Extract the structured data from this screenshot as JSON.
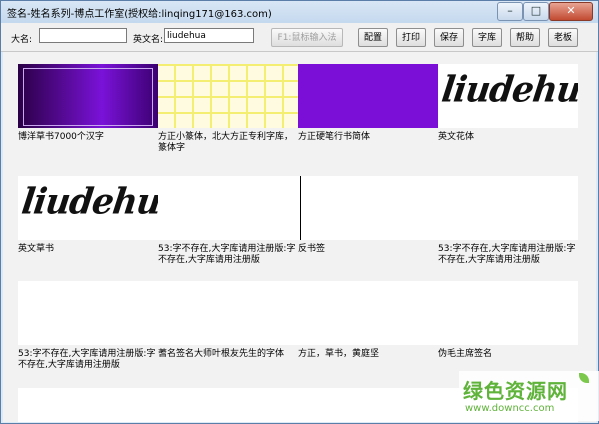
{
  "window": {
    "title": "签名-姓名系列-博点工作室(授权给:linqing171@163.com)"
  },
  "toolbar": {
    "name_label": "大名:",
    "name_value": "",
    "en_label": "英文名:",
    "en_value": "liudehua",
    "input_btn": "F1:鼠标输入法",
    "buttons": [
      "配置",
      "打印",
      "保存",
      "字库",
      "帮助",
      "老板"
    ]
  },
  "fonts": [
    {
      "caption": "博洋草书7000个汉字",
      "preview": "purple-gradient"
    },
    {
      "caption": "方正小篆体，北大方正专利字库，篆体字",
      "preview": "yellow-grid"
    },
    {
      "caption": "方正硬笔行书简体",
      "preview": "purple"
    },
    {
      "caption": "英文花体",
      "preview": "signature"
    },
    {
      "caption": "英文草书",
      "preview": "signature"
    },
    {
      "caption": "53:字不存在,大字库请用注册版:字不存在,大字库请用注册版",
      "preview": "blank"
    },
    {
      "caption": "反书签",
      "preview": "line"
    },
    {
      "caption": "53:字不存在,大字库请用注册版:字不存在,大字库请用注册版",
      "preview": "blank"
    },
    {
      "caption": "53:字不存在,大字库请用注册版:字不存在,大字库请用注册版",
      "preview": "blank"
    },
    {
      "caption": "蓍名签名大师叶根友先生的字体",
      "preview": "blank"
    },
    {
      "caption": "方正，草书，黄庭坚",
      "preview": "blank"
    },
    {
      "caption": "伪毛主席签名",
      "preview": "blank"
    }
  ],
  "signature_text": "liudehua",
  "watermark": {
    "cn": "绿色资源网",
    "url": "www.downcc.com"
  }
}
